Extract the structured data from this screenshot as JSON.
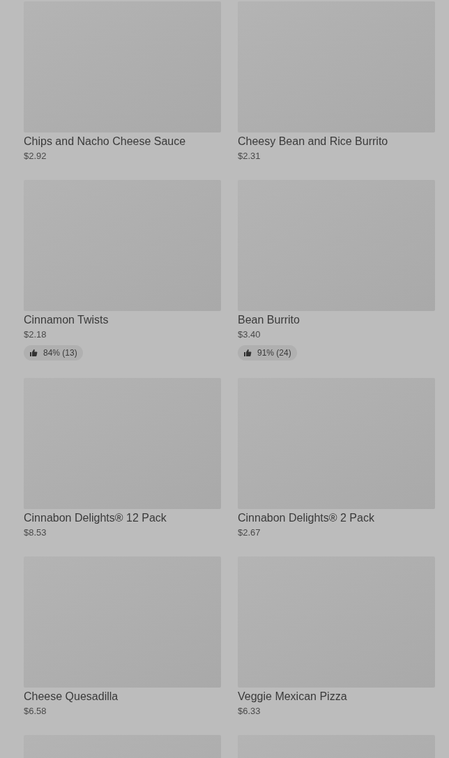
{
  "products": [
    {
      "kind": "product",
      "name": "Chips and Nacho Cheese Sauce",
      "price": "$2.92"
    },
    {
      "kind": "product",
      "name": "Cheesy Bean and Rice Burrito",
      "price": "$2.31"
    },
    {
      "kind": "product",
      "name": "Cinnamon Twists",
      "price": "$2.18",
      "rating": "84% (13)"
    },
    {
      "kind": "product",
      "name": "Bean Burrito",
      "price": "$3.40",
      "rating": "91% (24)"
    },
    {
      "kind": "product",
      "name": "Cinnabon Delights® 12 Pack",
      "price": "$8.53"
    },
    {
      "kind": "product",
      "name": "Cinnabon Delights® 2 Pack",
      "price": "$2.67"
    },
    {
      "kind": "product",
      "name": "Cheese Quesadilla",
      "price": "$6.58"
    },
    {
      "kind": "product",
      "name": "Veggie Mexican Pizza",
      "price": "$6.33"
    },
    {
      "kind": "image_only"
    },
    {
      "kind": "image_only"
    }
  ]
}
